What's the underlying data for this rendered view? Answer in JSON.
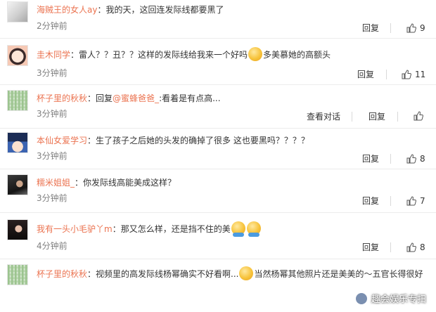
{
  "actions": {
    "reply": "回复",
    "view_dialog": "查看对话"
  },
  "comments": [
    {
      "user": "海贼王的女人ay",
      "sep": "：",
      "text": "我的天，这回连发际线都要黑了",
      "time": "2分钟前",
      "likes": "9"
    },
    {
      "user": "圭木同学",
      "sep": "：",
      "text_a": "雷人？？丑？？这样的发际线给我来一个好吗",
      "emoji": "嘻嘻",
      "text_b": "多美慕她的高额头",
      "time": "3分钟前",
      "likes": "11"
    },
    {
      "user": "杯子里的秋秋",
      "sep": "：",
      "text_a": "回复",
      "mention": "@蜜蜂爸爸_",
      "text_b": ":看着是有点高...",
      "time": "3分钟前",
      "likes": ""
    },
    {
      "user": "本仙女爱学习",
      "sep": "：",
      "text": "生了孩子之后她的头发的确掉了很多 这也要黑吗？？？？",
      "time": "3分钟前",
      "likes": "8"
    },
    {
      "user": "糯米姐姐_",
      "sep": "：",
      "text": "你发际线高能美成这样？",
      "time": "3分钟前",
      "likes": "7"
    },
    {
      "user": "我有一头小毛驴丫m",
      "sep": "：",
      "text": "那又怎么样，还是挡不住的美",
      "emoji": "抱抱",
      "time": "4分钟前",
      "likes": "8"
    },
    {
      "user": "杯子里的秋秋",
      "sep": "：",
      "text_a": "视频里的高发际线杨幂确实不好看啊...",
      "emoji": "作揖",
      "text_b": "当然杨幂其他照片还是美美的～五官长得很好"
    }
  ],
  "watermark": "趣会娱乐专扫"
}
